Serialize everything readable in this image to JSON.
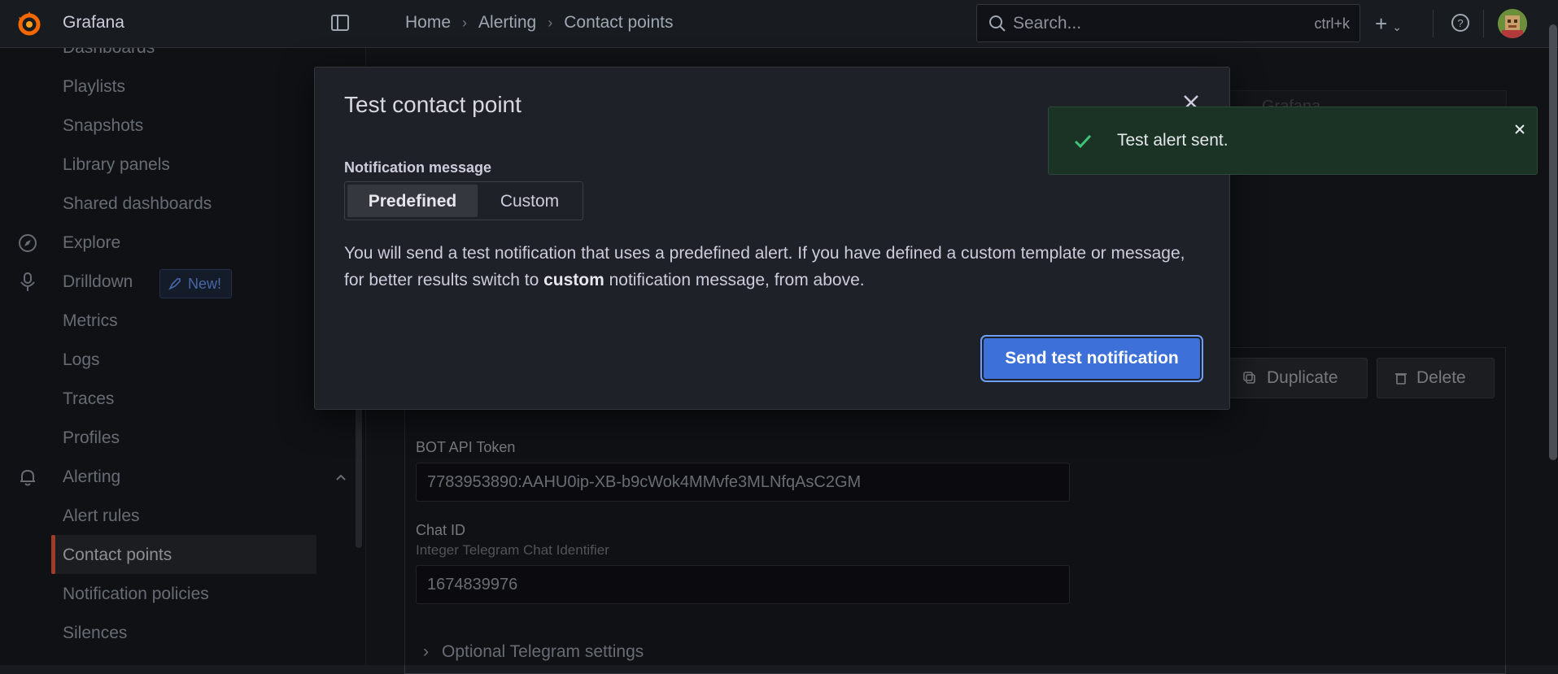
{
  "app": {
    "name": "Grafana"
  },
  "breadcrumb": [
    "Home",
    "Alerting",
    "Contact points"
  ],
  "search": {
    "placeholder": "Search...",
    "shortcut": "ctrl+k"
  },
  "sidebar": {
    "items": [
      {
        "label": "Dashboards"
      },
      {
        "label": "Playlists"
      },
      {
        "label": "Snapshots"
      },
      {
        "label": "Library panels"
      },
      {
        "label": "Shared dashboards"
      },
      {
        "label": "Explore"
      },
      {
        "label": "Drilldown",
        "badge": "New!"
      },
      {
        "label": "Metrics"
      },
      {
        "label": "Logs"
      },
      {
        "label": "Traces"
      },
      {
        "label": "Profiles"
      },
      {
        "label": "Alerting"
      },
      {
        "label": "Alert rules"
      },
      {
        "label": "Contact points"
      },
      {
        "label": "Notification policies"
      },
      {
        "label": "Silences"
      }
    ]
  },
  "background": {
    "select_label": "Grafana",
    "duplicate_label": "Duplicate",
    "delete_label": "Delete",
    "bot_token_label": "BOT API Token",
    "bot_token_value": "7783953890:AAHU0ip-XB-b9cWok4MMvfe3MLNfqAsC2GM",
    "chat_id_label": "Chat ID",
    "chat_id_description": "Integer Telegram Chat Identifier",
    "chat_id_value": "1674839976",
    "optional_settings": "Optional Telegram settings"
  },
  "modal": {
    "title": "Test contact point",
    "field_label": "Notification message",
    "options": [
      "Predefined",
      "Custom"
    ],
    "selected": "Predefined",
    "text_before": "You will send a test notification that uses a predefined alert. If you have defined a custom template or message, for better results switch to ",
    "text_bold": "custom",
    "text_after": " notification message, from above.",
    "send_button": "Send test notification"
  },
  "toast": {
    "message": "Test alert sent."
  },
  "colors": {
    "accent": "#f55f3e",
    "primary": "#3d71d9",
    "success": "#1a3324"
  }
}
